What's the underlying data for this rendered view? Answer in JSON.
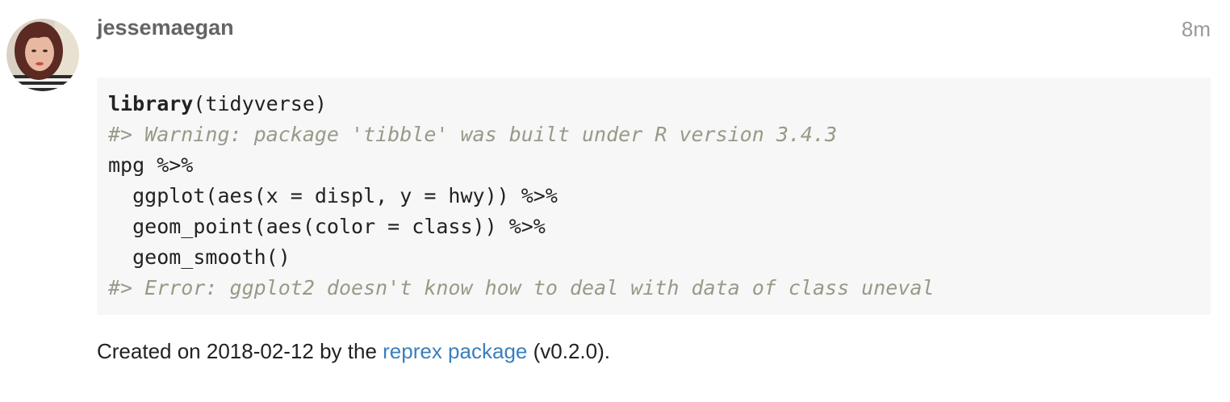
{
  "post": {
    "username": "jessemaegan",
    "timestamp": "8m",
    "avatar_icon": "user-avatar-photo"
  },
  "code": {
    "line1_fn": "library",
    "line1_rest": "(tidyverse)",
    "line2": "#> Warning: package 'tibble' was built under R version 3.4.3",
    "line3": "mpg %>%",
    "line4": "  ggplot(aes(x = displ, y = hwy)) %>%",
    "line5": "  geom_point(aes(color = class)) %>%",
    "line6": "  geom_smooth()",
    "line7": "#> Error: ggplot2 doesn't know how to deal with data of class uneval"
  },
  "footer": {
    "prefix": "Created on 2018-02-12 by the ",
    "link_text": "reprex package",
    "suffix": " (v0.2.0)."
  },
  "colors": {
    "username": "#646464",
    "timestamp": "#9a9a9a",
    "code_background": "#f7f7f7",
    "comment": "#999988",
    "link": "#3a7fbf"
  }
}
